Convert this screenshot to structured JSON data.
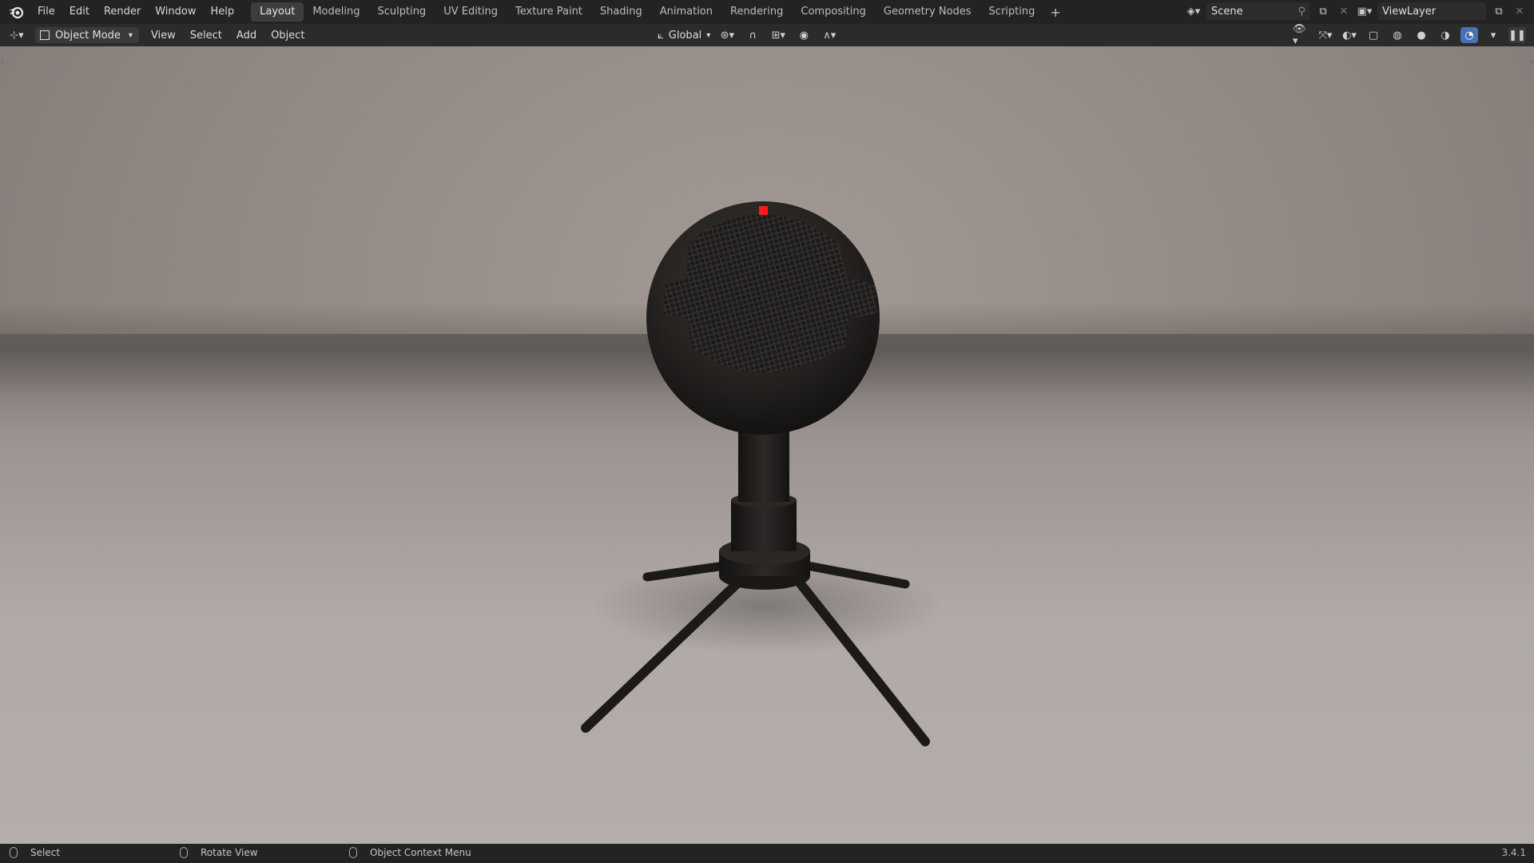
{
  "menu": [
    "File",
    "Edit",
    "Render",
    "Window",
    "Help"
  ],
  "workspaces": {
    "tabs": [
      "Layout",
      "Modeling",
      "Sculpting",
      "UV Editing",
      "Texture Paint",
      "Shading",
      "Animation",
      "Rendering",
      "Compositing",
      "Geometry Nodes",
      "Scripting"
    ],
    "active": "Layout",
    "add_label": "+"
  },
  "scene": {
    "name": "Scene"
  },
  "view_layer": {
    "name": "ViewLayer"
  },
  "header": {
    "mode": "Object Mode",
    "menus": [
      "View",
      "Select",
      "Add",
      "Object"
    ],
    "transform_orientation": "Global"
  },
  "icons": {
    "editor_type": "editor-type-icon",
    "snap": "magnet-icon",
    "proportional": "proportional-edit-icon",
    "shading_modes": [
      "wireframe-icon",
      "solid-icon",
      "material-preview-icon",
      "rendered-icon"
    ]
  },
  "viewport": {
    "subject": "microphone-render",
    "led_color": "#ff1a1a"
  },
  "statusbar": {
    "select": "Select",
    "rotate": "Rotate View",
    "context": "Object Context Menu",
    "version": "3.4.1"
  }
}
